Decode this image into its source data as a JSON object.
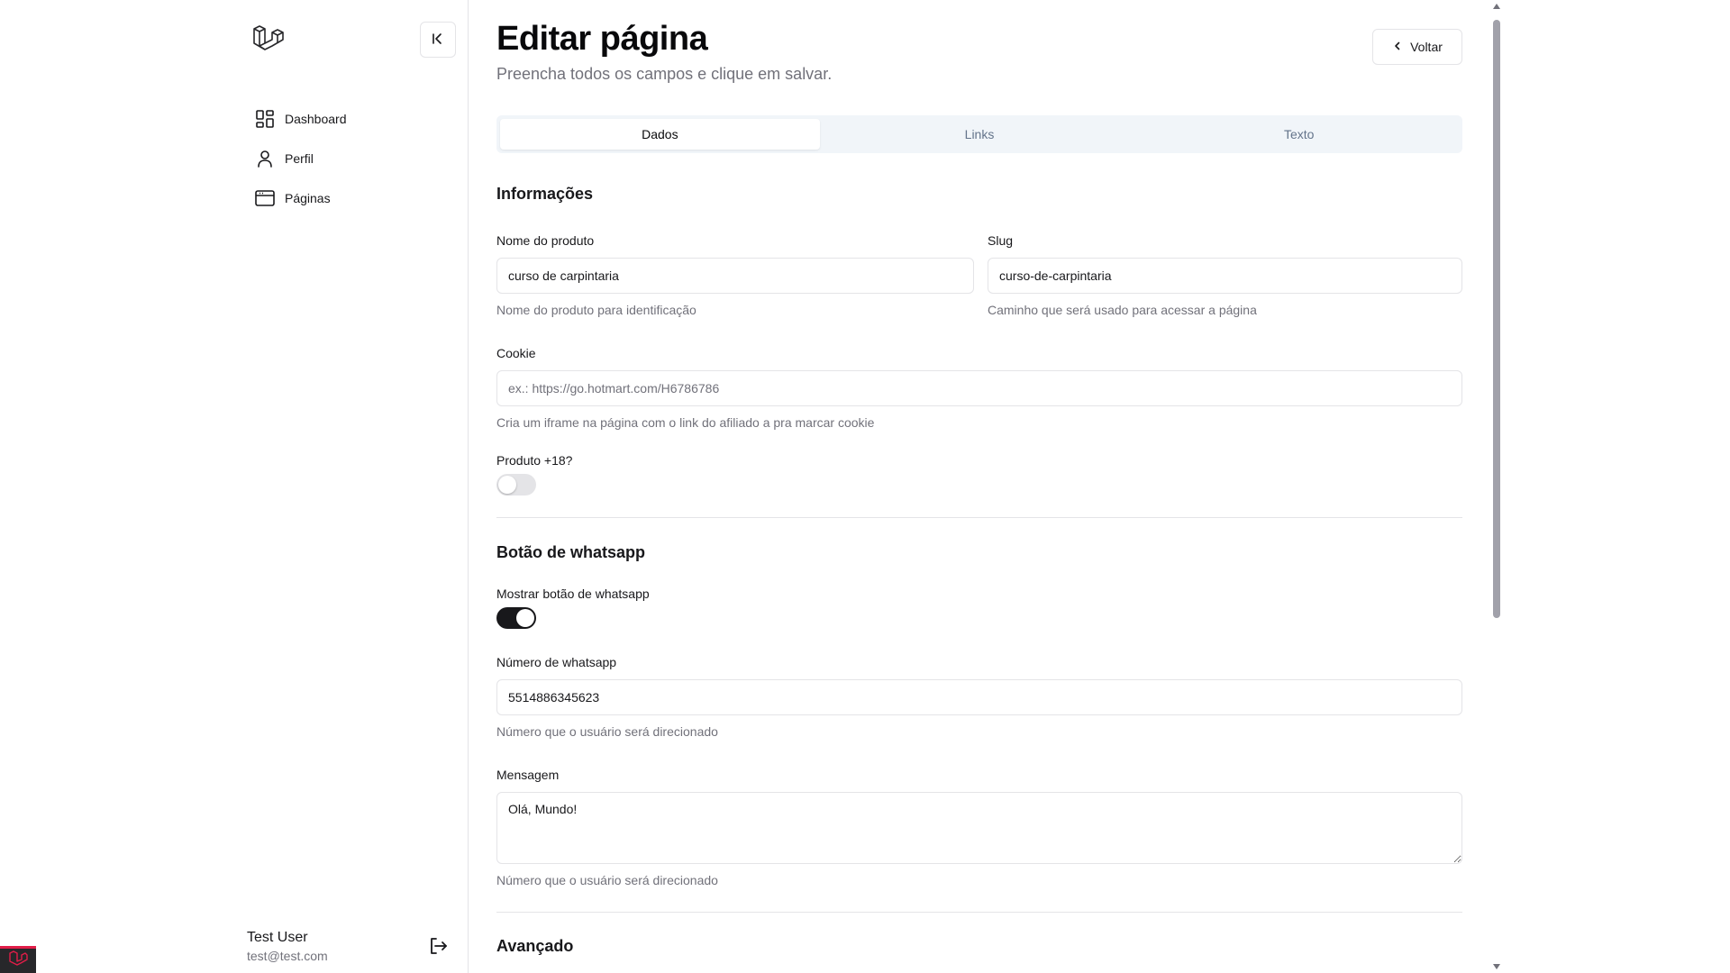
{
  "sidebar": {
    "items": [
      {
        "label": "Dashboard",
        "icon": "dashboard-icon"
      },
      {
        "label": "Perfil",
        "icon": "user-icon"
      },
      {
        "label": "Páginas",
        "icon": "browser-window-icon"
      }
    ],
    "user": {
      "name": "Test User",
      "email": "test@test.com"
    }
  },
  "header": {
    "title": "Editar página",
    "subtitle": "Preencha todos os campos e clique em salvar.",
    "back_label": "Voltar"
  },
  "tabs": [
    {
      "label": "Dados",
      "active": true
    },
    {
      "label": "Links",
      "active": false
    },
    {
      "label": "Texto",
      "active": false
    }
  ],
  "info": {
    "title": "Informações",
    "product_name": {
      "label": "Nome do produto",
      "value": "curso de carpintaria",
      "help": "Nome do produto para identificação"
    },
    "slug": {
      "label": "Slug",
      "value": "curso-de-carpintaria",
      "help": "Caminho que será usado para acessar a página"
    },
    "cookie": {
      "label": "Cookie",
      "value": "",
      "placeholder": "ex.: https://go.hotmart.com/H6786786",
      "help": "Cria um iframe na página com o link do afiliado a pra marcar cookie"
    },
    "adult": {
      "label": "Produto +18?",
      "checked": false
    }
  },
  "whatsapp": {
    "title": "Botão de whatsapp",
    "show": {
      "label": "Mostrar botão de whatsapp",
      "checked": true
    },
    "number": {
      "label": "Número de whatsapp",
      "value": "5514886345623",
      "help": "Número que o usuário será direcionado"
    },
    "message": {
      "label": "Mensagem",
      "value": "Olá, Mundo!",
      "help": "Número que o usuário será direcionado"
    }
  },
  "advanced": {
    "title": "Avançado"
  },
  "colors": {
    "accent": "#18181b",
    "border": "#e4e4e7",
    "muted": "#71717a",
    "tabs_bg": "#f1f5f9",
    "badge_red": "#e11d48"
  }
}
